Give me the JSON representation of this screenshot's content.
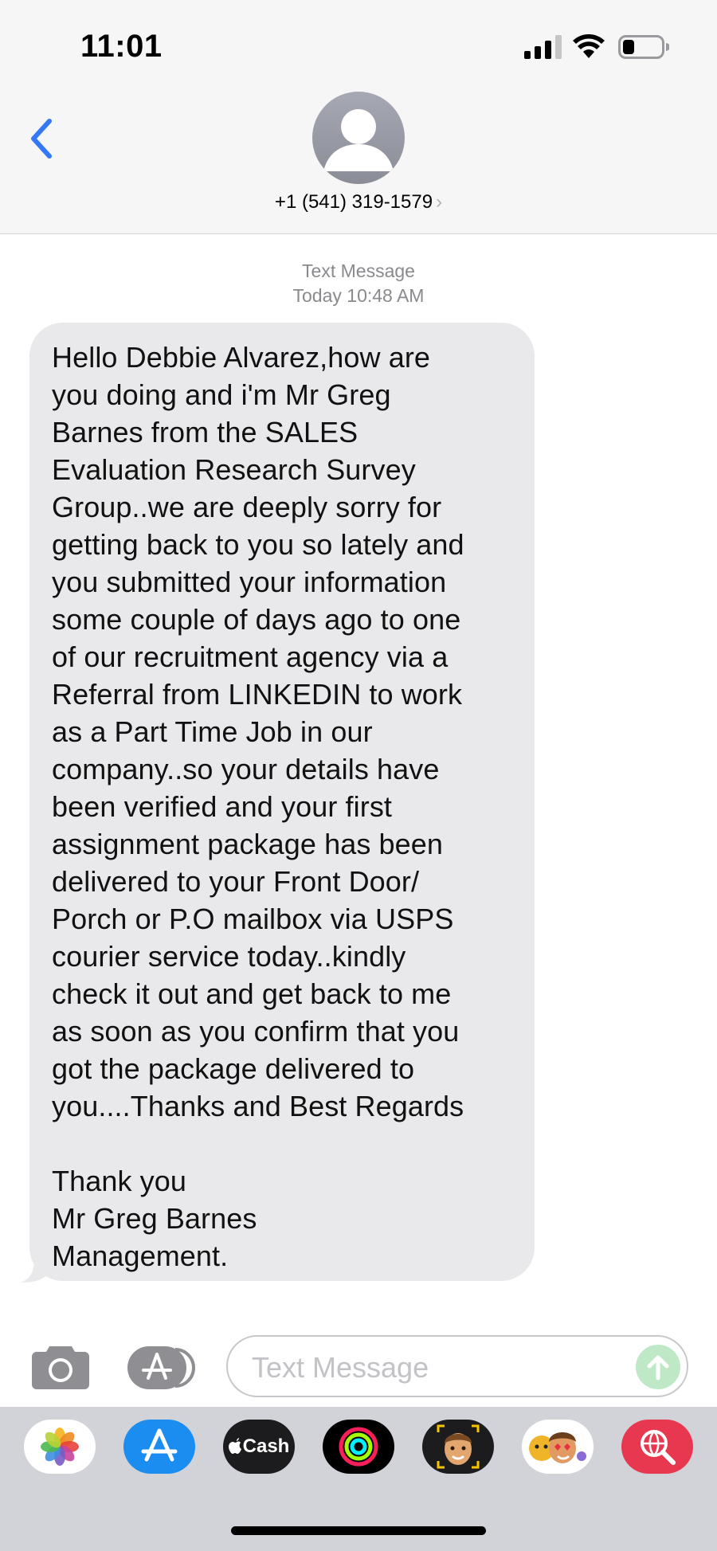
{
  "status_bar": {
    "time": "11:01"
  },
  "header": {
    "contact": "+1 (541) 319-1579",
    "chevron": "›"
  },
  "thread": {
    "service": "Text Message",
    "timestamp": "Today 10:48 AM",
    "message": "Hello Debbie Alvarez,how are\nyou doing and i'm Mr Greg\nBarnes from the SALES\nEvaluation Research Survey\nGroup..we are deeply sorry for\ngetting back to you so lately and\nyou submitted your information\nsome couple of days ago to one\nof our recruitment agency via a\nReferral from LINKEDIN to work\nas a Part Time Job in our\ncompany..so your details have\nbeen verified and your first\nassignment package has been\ndelivered to your Front Door/\nPorch or P.O mailbox via USPS\ncourier service today..kindly\ncheck it out and get back to me\nas soon as you confirm that you\ngot the package delivered to\nyou....Thanks and Best Regards\n\nThank you\nMr Greg Barnes\nManagement."
  },
  "composer": {
    "placeholder": "Text Message"
  },
  "drawer": {
    "cash_label": "Cash",
    "apps": [
      "photos-icon",
      "app-store-icon",
      "apple-cash-icon",
      "activity-icon",
      "memoji-icon",
      "memoji-stickers-icon",
      "web-search-icon"
    ]
  },
  "colors": {
    "accent": "#3478f6",
    "bubble": "#e9e9eb",
    "send": "#bfe9c6"
  }
}
